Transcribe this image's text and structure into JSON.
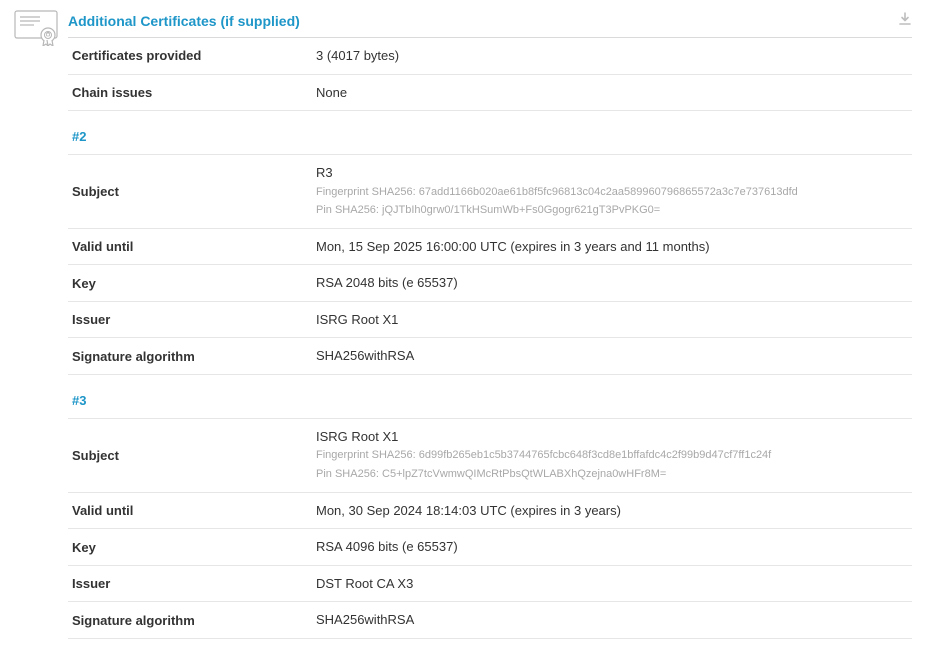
{
  "section": {
    "title": "Additional Certificates (if supplied)"
  },
  "summary": {
    "certs_provided_label": "Certificates provided",
    "certs_provided_value": "3 (4017 bytes)",
    "chain_issues_label": "Chain issues",
    "chain_issues_value": "None"
  },
  "cert2": {
    "num": "#2",
    "subject_label": "Subject",
    "subject_value": "R3",
    "subject_fp": "Fingerprint SHA256: 67add1166b020ae61b8f5fc96813c04c2aa589960796865572a3c7e737613dfd",
    "subject_pin": "Pin SHA256: jQJTbIh0grw0/1TkHSumWb+Fs0Ggogr621gT3PvPKG0=",
    "valid_label": "Valid until",
    "valid_value": "Mon, 15 Sep 2025 16:00:00 UTC (expires in 3 years and 11 months)",
    "key_label": "Key",
    "key_value": "RSA 2048 bits (e 65537)",
    "issuer_label": "Issuer",
    "issuer_value": "ISRG Root X1",
    "sigalg_label": "Signature algorithm",
    "sigalg_value": "SHA256withRSA"
  },
  "cert3": {
    "num": "#3",
    "subject_label": "Subject",
    "subject_value": "ISRG Root X1",
    "subject_fp": "Fingerprint SHA256: 6d99fb265eb1c5b3744765fcbc648f3cd8e1bffafdc4c2f99b9d47cf7ff1c24f",
    "subject_pin": "Pin SHA256: C5+lpZ7tcVwmwQIMcRtPbsQtWLABXhQzejna0wHFr8M=",
    "valid_label": "Valid until",
    "valid_value": "Mon, 30 Sep 2024 18:14:03 UTC (expires in 3 years)",
    "key_label": "Key",
    "key_value": "RSA 4096 bits (e 65537)",
    "issuer_label": "Issuer",
    "issuer_value": "DST Root CA X3",
    "sigalg_label": "Signature algorithm",
    "sigalg_value": "SHA256withRSA"
  }
}
